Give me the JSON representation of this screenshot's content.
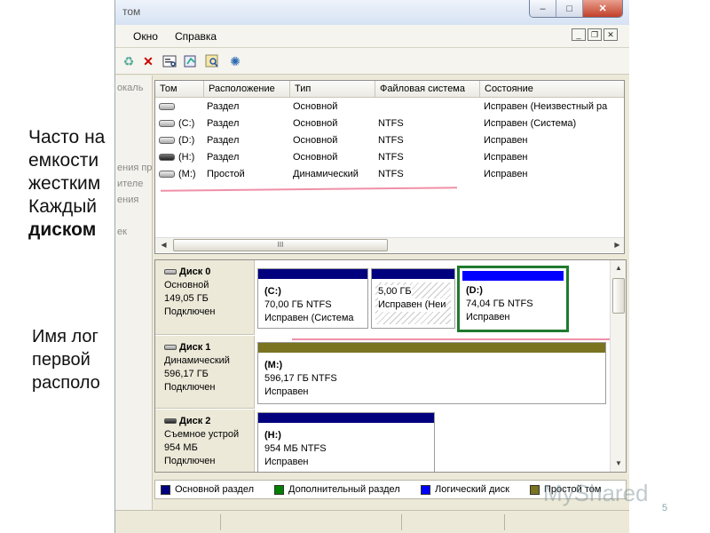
{
  "slide": {
    "para1_lines": [
      "Часто на",
      "емкости",
      "жестким",
      "Каждый"
    ],
    "para1_bold": "диском",
    "para2_lines": [
      "Имя лог",
      "первой",
      "располо"
    ],
    "page_number": "5",
    "watermark": "MyShared"
  },
  "window": {
    "title_fragment": "том",
    "controls": {
      "minimize": "–",
      "maximize": "□",
      "close": "✕"
    }
  },
  "menu": {
    "items": [
      "Окно",
      "Справка"
    ],
    "mdi": {
      "minimize": "_",
      "restore": "❐",
      "close": "✕"
    }
  },
  "left_pane": {
    "fragments": [
      "окаль",
      "ения пр",
      "ителе",
      "ения",
      "ек"
    ]
  },
  "volumes": {
    "columns": [
      "Том",
      "Расположение",
      "Тип",
      "Файловая система",
      "Состояние"
    ],
    "rows": [
      {
        "name": "",
        "layout": "Раздел",
        "type": "Основной",
        "fs": "",
        "status": "Исправен (Неизвестный ра"
      },
      {
        "name": "(C:)",
        "layout": "Раздел",
        "type": "Основной",
        "fs": "NTFS",
        "status": "Исправен (Система)"
      },
      {
        "name": "(D:)",
        "layout": "Раздел",
        "type": "Основной",
        "fs": "NTFS",
        "status": "Исправен"
      },
      {
        "name": "(H:)",
        "layout": "Раздел",
        "type": "Основной",
        "fs": "NTFS",
        "status": "Исправен"
      },
      {
        "name": "(M:)",
        "layout": "Простой",
        "type": "Динамический",
        "fs": "NTFS",
        "status": "Исправен"
      }
    ],
    "scroll_grip": "III"
  },
  "disks": [
    {
      "name": "Диск 0",
      "kind": "Основной",
      "size": "149,05 ГБ",
      "state": "Подключен",
      "partitions": [
        {
          "label": "(C:)",
          "size": "70,00 ГБ NTFS",
          "status": "Исправен (Система",
          "color": "#00007f"
        },
        {
          "label": "",
          "size": "5,00 ГБ",
          "status": "Исправен (Неи",
          "color": "#00007f"
        },
        {
          "label": "(D:)",
          "size": "74,04 ГБ NTFS",
          "status": "Исправен",
          "color": "#0000ff"
        }
      ]
    },
    {
      "name": "Диск 1",
      "kind": "Динамический",
      "size": "596,17 ГБ",
      "state": "Подключен",
      "partitions": [
        {
          "label": "(M:)",
          "size": "596,17 ГБ NTFS",
          "status": "Исправен",
          "color": "#7a7320"
        }
      ]
    },
    {
      "name": "Диск 2",
      "kind": "Съемное устрой",
      "size": "954 МБ",
      "state": "Подключен",
      "partitions": [
        {
          "label": "(H:)",
          "size": "954 МБ NTFS",
          "status": "Исправен",
          "color": "#00007f"
        }
      ]
    }
  ],
  "legend": [
    {
      "label": "Основной раздел",
      "color": "#00007f"
    },
    {
      "label": "Дополнительный раздел",
      "color": "#008000"
    },
    {
      "label": "Логический диск",
      "color": "#0000ff"
    },
    {
      "label": "Простой том",
      "color": "#7a7320"
    }
  ],
  "colors": {
    "selected_outline": "#1f7a2e",
    "annotation_underline": "#e6466e"
  }
}
